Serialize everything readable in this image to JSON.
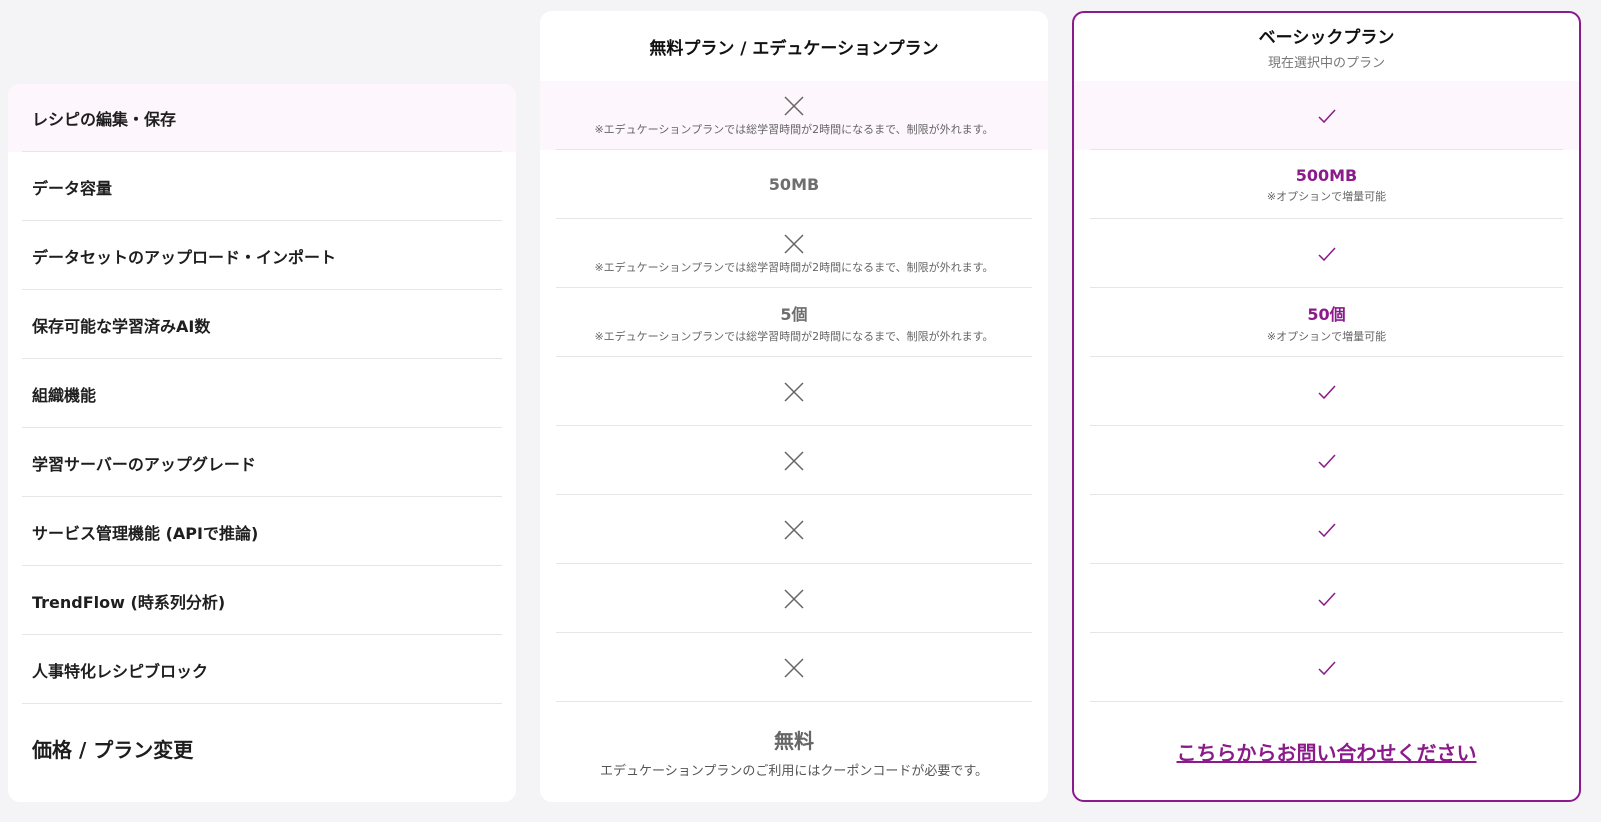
{
  "features": {
    "rows": [
      "レシピの編集・保存",
      "データ容量",
      "データセットのアップロード・インポート",
      "保存可能な学習済みAI数",
      "組織機能",
      "学習サーバーのアップグレード",
      "サービス管理機能 (APIで推論)",
      "TrendFlow (時系列分析)",
      "人事特化レシピブロック"
    ],
    "price_label": "価格 / プラン変更"
  },
  "free_plan": {
    "title": "無料プラン / エデュケーションプラン",
    "edu_note": "※エデュケーションプランでは総学習時間が2時間になるまで、制限が外れます。",
    "storage": "50MB",
    "ai_count": "5個",
    "price": "無料",
    "price_note": "エデュケーションプランのご利用にはクーポンコードが必要です。"
  },
  "basic_plan": {
    "title": "ベーシックプラン",
    "subtitle": "現在選択中のプラン",
    "storage": "500MB",
    "ai_count": "50個",
    "option_note": "※オプションで増量可能",
    "contact_link": "こちらからお問い合わせください"
  },
  "colors": {
    "accent": "#8b1a8b",
    "highlight_row": "#fdf6fc",
    "background": "#f4f4f6"
  },
  "icons": {
    "cross": "cross-icon",
    "check": "check-icon"
  }
}
